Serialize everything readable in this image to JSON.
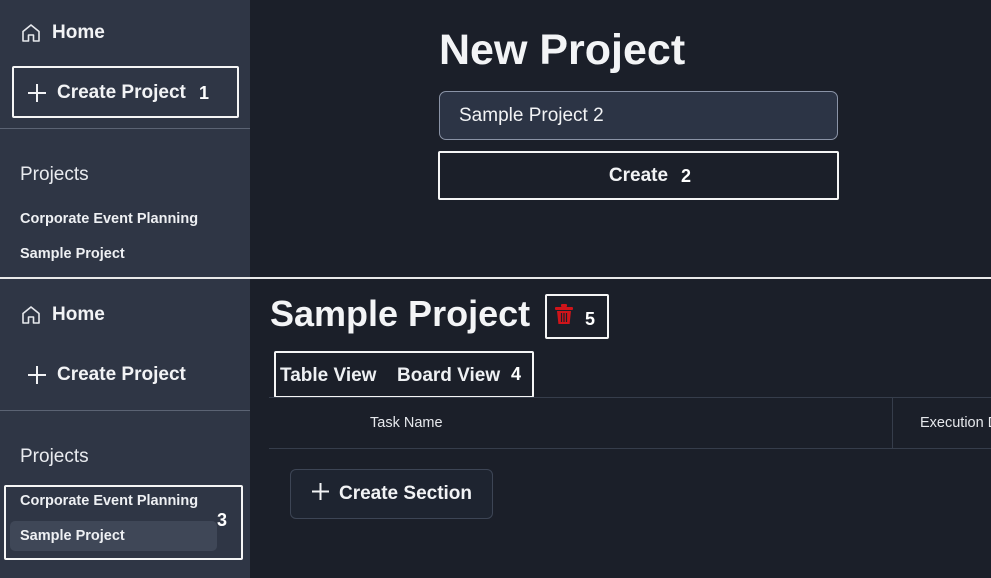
{
  "top_panel": {
    "sidebar": {
      "home_label": "Home",
      "create_project_label": "Create Project",
      "projects_heading": "Projects",
      "projects": [
        "Corporate Event Planning",
        "Sample Project"
      ]
    },
    "main": {
      "title": "New Project",
      "project_name_value": "Sample Project 2",
      "create_button_label": "Create"
    }
  },
  "bottom_panel": {
    "sidebar": {
      "home_label": "Home",
      "create_project_label": "Create Project",
      "projects_heading": "Projects",
      "projects": [
        "Corporate Event Planning",
        "Sample Project"
      ],
      "selected_project": "Sample Project"
    },
    "main": {
      "project_title": "Sample Project",
      "tabs": [
        "Table View",
        "Board View"
      ],
      "columns": [
        "Task Name",
        "Execution D"
      ],
      "create_section_label": "Create Section"
    }
  },
  "annotations": [
    "1",
    "2",
    "3",
    "4",
    "5"
  ],
  "colors": {
    "sidebar_bg": "#2f3645",
    "main_bg": "#1b1f29",
    "input_bg": "#2c3445",
    "selected_bg": "#3f4757",
    "highlight": "#f5f5f5",
    "delete_icon": "#d0141a"
  },
  "icons": {
    "home": "home-icon",
    "create_project": "plus-icon",
    "delete": "trash-icon",
    "create_section": "plus-icon"
  }
}
